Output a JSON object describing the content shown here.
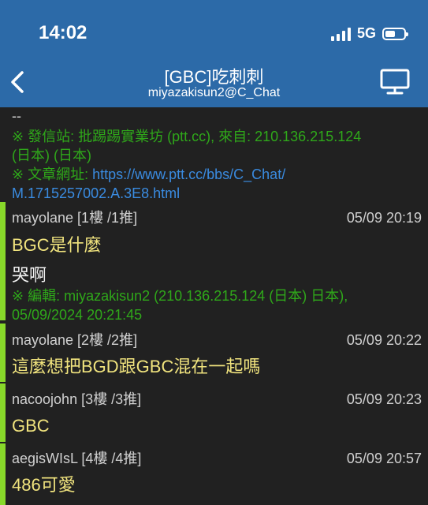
{
  "status": {
    "time": "14:02",
    "network": "5G"
  },
  "nav": {
    "title": "[GBC]吃刺刺",
    "subtitle": "miyazakisun2@C_Chat"
  },
  "article": {
    "separator": "--",
    "source_line1": "※ 發信站: 批踢踢實業坊 (ptt.cc), 來自: 210.136.215.124",
    "source_line2": "(日本) (日本)",
    "url_label": "※ 文章網址: ",
    "url_line1": "https://www.ptt.cc/bbs/C_Chat/",
    "url_line2": "M.1715257002.A.3E8.html"
  },
  "comments": [
    {
      "meta": "mayolane [1樓 /1推]",
      "time": "05/09 20:19",
      "text": "BGC是什麼"
    },
    {
      "meta": "mayolane [2樓 /2推]",
      "time": "05/09 20:22",
      "text": "這麼想把BGD跟GBC混在一起嗎"
    },
    {
      "meta": "nacoojohn [3樓 /3推]",
      "time": "05/09 20:23",
      "text": "GBC"
    },
    {
      "meta": "aegisWIsL [4樓 /4推]",
      "time": "05/09 20:57",
      "text": "486可愛"
    }
  ],
  "reply": {
    "text": "哭啊",
    "edit_line1": "※ 編輯: miyazakisun2 (210.136.215.124 (日本) 日本),",
    "edit_line2": "05/09/2024 20:21:45"
  },
  "colors": {
    "nav_bg": "#2c6aa8",
    "content_bg": "#212121",
    "push_bar": "#88d92a"
  }
}
